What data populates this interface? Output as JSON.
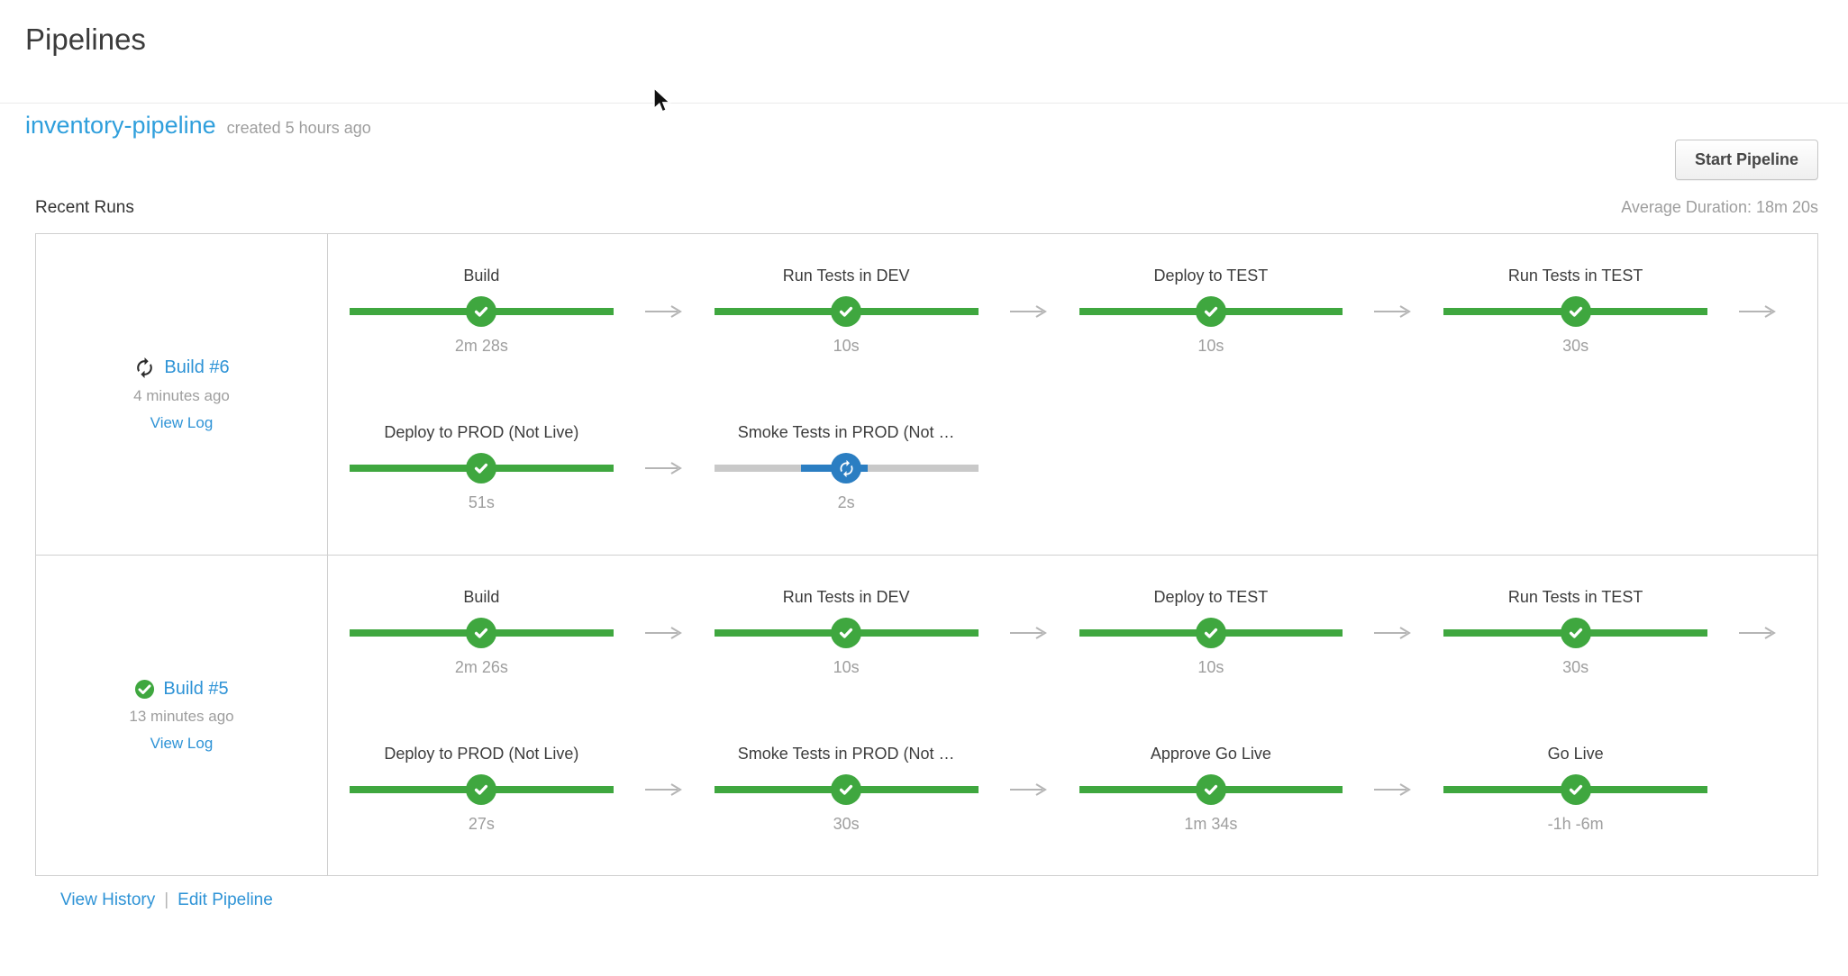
{
  "page": {
    "title": "Pipelines"
  },
  "pipeline": {
    "name": "inventory-pipeline",
    "created": "created 5 hours ago",
    "start_button": "Start Pipeline",
    "recent_runs_label": "Recent Runs",
    "average_duration": "Average Duration: 18m 20s"
  },
  "footer": {
    "view_history": "View History",
    "separator": "|",
    "edit_pipeline": "Edit Pipeline"
  },
  "colors": {
    "success_green": "#3fa73f",
    "running_blue": "#2b7ec2",
    "link_blue": "#2e93d6",
    "title_blue": "#2f9fdc",
    "text_dark": "#3c3c3c",
    "text_gray": "#9e9e9e",
    "bar_gray": "#c9c9c9",
    "arrow_gray": "#b5b5b5",
    "border_gray": "#cfcfcf"
  },
  "icons": {
    "run_running": "sync-icon",
    "run_succeeded": "check-circle-icon",
    "stage_succeeded": "check-icon",
    "stage_running": "sync-icon",
    "between_stages": "arrow-right-icon"
  },
  "runs": [
    {
      "name": "Build #6",
      "status": "running",
      "time": "4 minutes ago",
      "log_label": "View Log",
      "lines": [
        {
          "trailing_arrow": true,
          "stages": [
            {
              "name": "Build",
              "duration": "2m 28s",
              "state": "succeeded"
            },
            {
              "name": "Run Tests in DEV",
              "duration": "10s",
              "state": "succeeded"
            },
            {
              "name": "Deploy to TEST",
              "duration": "10s",
              "state": "succeeded"
            },
            {
              "name": "Run Tests in TEST",
              "duration": "30s",
              "state": "succeeded"
            }
          ]
        },
        {
          "trailing_arrow": false,
          "stages": [
            {
              "name": "Deploy to PROD (Not Live)",
              "duration": "51s",
              "state": "succeeded"
            },
            {
              "name": "Smoke Tests in PROD (Not …",
              "duration": "2s",
              "state": "running"
            }
          ]
        }
      ]
    },
    {
      "name": "Build #5",
      "status": "succeeded",
      "time": "13 minutes ago",
      "log_label": "View Log",
      "lines": [
        {
          "trailing_arrow": true,
          "stages": [
            {
              "name": "Build",
              "duration": "2m 26s",
              "state": "succeeded"
            },
            {
              "name": "Run Tests in DEV",
              "duration": "10s",
              "state": "succeeded"
            },
            {
              "name": "Deploy to TEST",
              "duration": "10s",
              "state": "succeeded"
            },
            {
              "name": "Run Tests in TEST",
              "duration": "30s",
              "state": "succeeded"
            }
          ]
        },
        {
          "trailing_arrow": false,
          "stages": [
            {
              "name": "Deploy to PROD (Not Live)",
              "duration": "27s",
              "state": "succeeded"
            },
            {
              "name": "Smoke Tests in PROD (Not …",
              "duration": "30s",
              "state": "succeeded"
            },
            {
              "name": "Approve Go Live",
              "duration": "1m 34s",
              "state": "succeeded"
            },
            {
              "name": "Go Live",
              "duration": "-1h -6m",
              "state": "succeeded"
            }
          ]
        }
      ]
    }
  ]
}
